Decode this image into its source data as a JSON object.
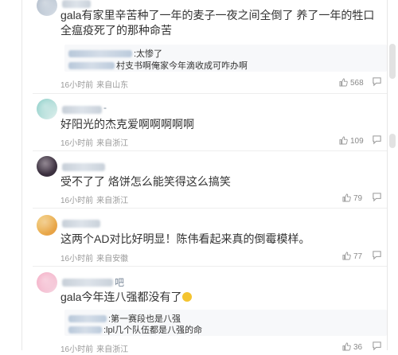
{
  "comments": [
    {
      "text": "gala有家里辛苦种了一年的麦子一夜之间全倒了 养了一年的牲口全瘟疫死了的那种命苦",
      "replies": [
        {
          "text": ":太惨了"
        },
        {
          "text": "村支书啊俺家今年滴收成可咋办啊"
        }
      ],
      "time": "16小时前",
      "source": "来自山东",
      "likes": "568"
    },
    {
      "name_suffix": "-",
      "text": "好阳光的杰克爱啊啊啊啊啊",
      "time": "16小时前",
      "source": "来自浙江",
      "likes": "109"
    },
    {
      "text": "受不了了 烙饼怎么能笑得这么搞笑",
      "time": "16小时前",
      "source": "来自浙江",
      "likes": "79"
    },
    {
      "text": "这两个AD对比好明显！陈伟看起来真的倒霉模样。",
      "time": "16小时前",
      "source": "来自安徽",
      "likes": "77"
    },
    {
      "name_suffix": "吧",
      "text": "gala今年连八强都没有了",
      "replies": [
        {
          "text": ":第一赛段也是八强"
        },
        {
          "text": ":lpl几个队伍都是八强的命"
        }
      ],
      "time": "16小时前",
      "source": "来自浙江",
      "likes": "36"
    }
  ],
  "colors": {
    "text": "#333333",
    "meta": "#9a9a9a",
    "reply_bg": "#f7f8fa"
  },
  "icons": [
    "thumbs-up-icon",
    "reply-icon",
    "emoji-icon"
  ]
}
